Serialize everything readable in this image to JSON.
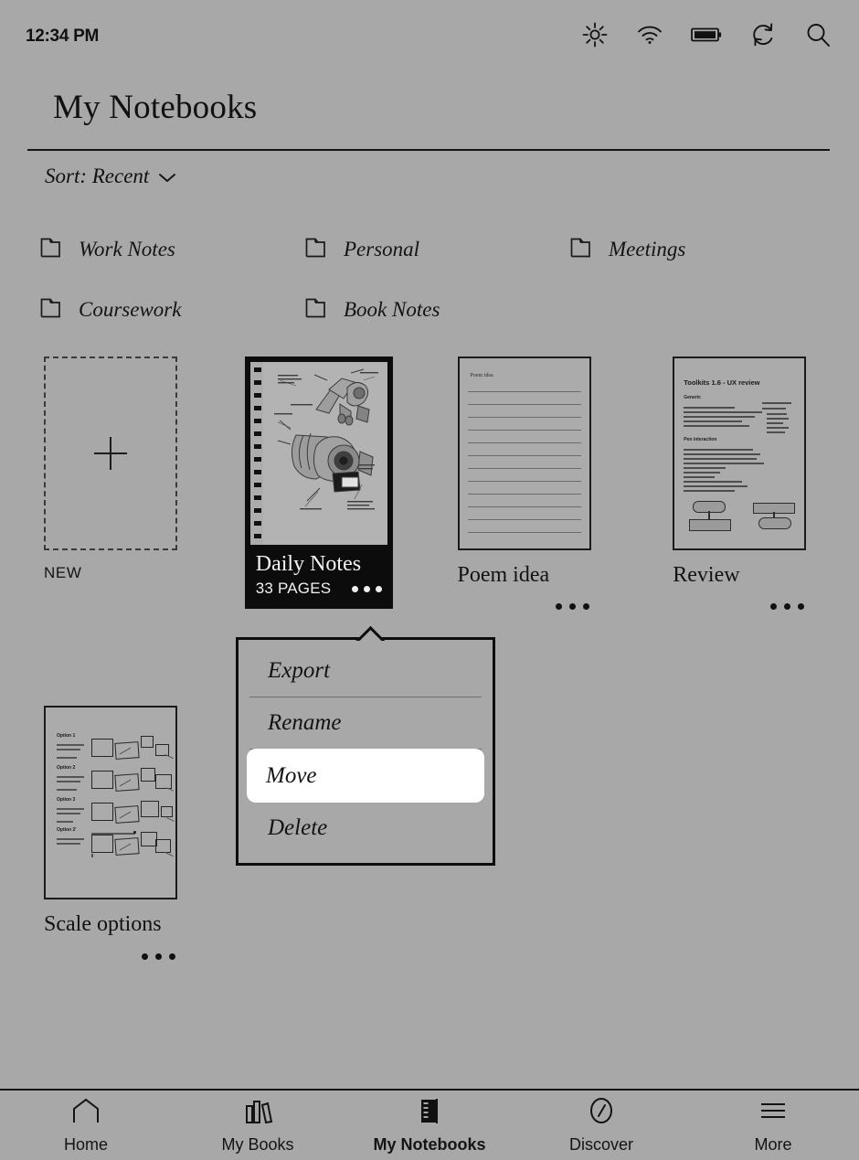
{
  "statusbar": {
    "time": "12:34 PM",
    "icons": [
      {
        "name": "brightness-icon",
        "label": "brightness"
      },
      {
        "name": "wifi-icon",
        "label": "wifi"
      },
      {
        "name": "battery-icon",
        "label": "battery"
      },
      {
        "name": "sync-icon",
        "label": "sync"
      },
      {
        "name": "search-icon",
        "label": "search"
      }
    ]
  },
  "header": {
    "title": "My Notebooks"
  },
  "sort": {
    "label": "Sort: Recent",
    "chevron": "chevron-down-icon"
  },
  "folders": [
    {
      "label": "Work Notes"
    },
    {
      "label": "Personal"
    },
    {
      "label": "Meetings"
    },
    {
      "label": "Coursework"
    },
    {
      "label": "Book Notes"
    }
  ],
  "new_item": {
    "label": "NEW",
    "icon": "plus-icon"
  },
  "notebooks": [
    {
      "title": "Daily Notes",
      "pages": "33 PAGES",
      "selected": true,
      "thumb_kind": "sketch"
    },
    {
      "title": "Poem idea",
      "selected": false,
      "thumb_kind": "ruled",
      "thumb_text": "Poem idea"
    },
    {
      "title": "Review",
      "selected": false,
      "thumb_kind": "document",
      "thumb_title": "Toolkits 1.6 - UX review",
      "thumb_sections": [
        "Generic",
        "Pen interaction"
      ]
    },
    {
      "title": "Scale options",
      "selected": false,
      "thumb_kind": "diagram",
      "thumb_options": [
        "Option 1",
        "Option 2",
        "Option 3",
        "Option 2'"
      ]
    }
  ],
  "context_menu": {
    "items": [
      {
        "label": "Export",
        "selected": false
      },
      {
        "label": "Rename",
        "selected": false
      },
      {
        "label": "Move",
        "selected": true
      },
      {
        "label": "Delete",
        "selected": false
      }
    ]
  },
  "navbar": {
    "items": [
      {
        "label": "Home",
        "icon": "home-icon",
        "active": false
      },
      {
        "label": "My Books",
        "icon": "books-icon",
        "active": false
      },
      {
        "label": "My Notebooks",
        "icon": "notebook-icon",
        "active": true
      },
      {
        "label": "Discover",
        "icon": "compass-icon",
        "active": false
      },
      {
        "label": "More",
        "icon": "hamburger-icon",
        "active": false
      }
    ]
  },
  "colors": {
    "background": "#a8a8a8",
    "ink": "#121212",
    "selected_card": "#0c0c0c",
    "highlight": "#ffffff"
  }
}
